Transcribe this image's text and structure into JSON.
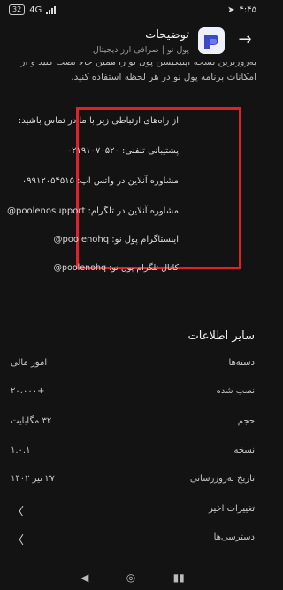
{
  "status_bar": {
    "time": "۴:۴۵",
    "battery": "32",
    "network": "4G"
  },
  "app_bar": {
    "title": "توضیحات",
    "subtitle": "پول نو | صرافی ارز دیجیتال"
  },
  "description": {
    "line1": "به‌روزترین نسخه اپلیکیشن پول نو را همین حالا نصب کنید و از",
    "line2": "امکانات برنامه پول نو در هر لحظه استفاده کنید."
  },
  "contact": {
    "intro": "از راه‌های ارتباطی زیر با ما در تماس باشید:",
    "phone": "پشتیبانی تلفنی: ۰۲۱۹۱۰۷۰۵۲۰",
    "whatsapp": "مشاوره آنلاین در واتس اپ: ۰۹۹۱۲۰۵۴۵۱۵",
    "telegram_support": "مشاوره آنلاین در تلگرام: poolenosupport@",
    "instagram": "اینستاگرام پول نو: poolenohq@",
    "telegram_channel": "کانال تلگرام پول نو: poolenohq@"
  },
  "other_info": {
    "title": "سایر اطلاعات",
    "rows": [
      {
        "label": "دسته‌ها",
        "value": "امور مالی"
      },
      {
        "label": "نصب شده",
        "value": "+۲۰،۰۰۰"
      },
      {
        "label": "حجم",
        "value": "۳۲ مگابایت"
      },
      {
        "label": "نسخه",
        "value": "۱.۰.۱"
      },
      {
        "label": "تاریخ به‌روزرسانی",
        "value": "۲۷ تیر ۱۴۰۲"
      },
      {
        "label": "تغییرات اخیر",
        "value": ""
      },
      {
        "label": "دسترسی‌ها",
        "value": ""
      }
    ]
  },
  "colors": {
    "background": "#131313",
    "highlight_border": "#e0202a"
  },
  "icons": {
    "back": "arrow-right-icon",
    "app": "poolno-logo-icon",
    "chevron": "chevron-left-icon"
  }
}
